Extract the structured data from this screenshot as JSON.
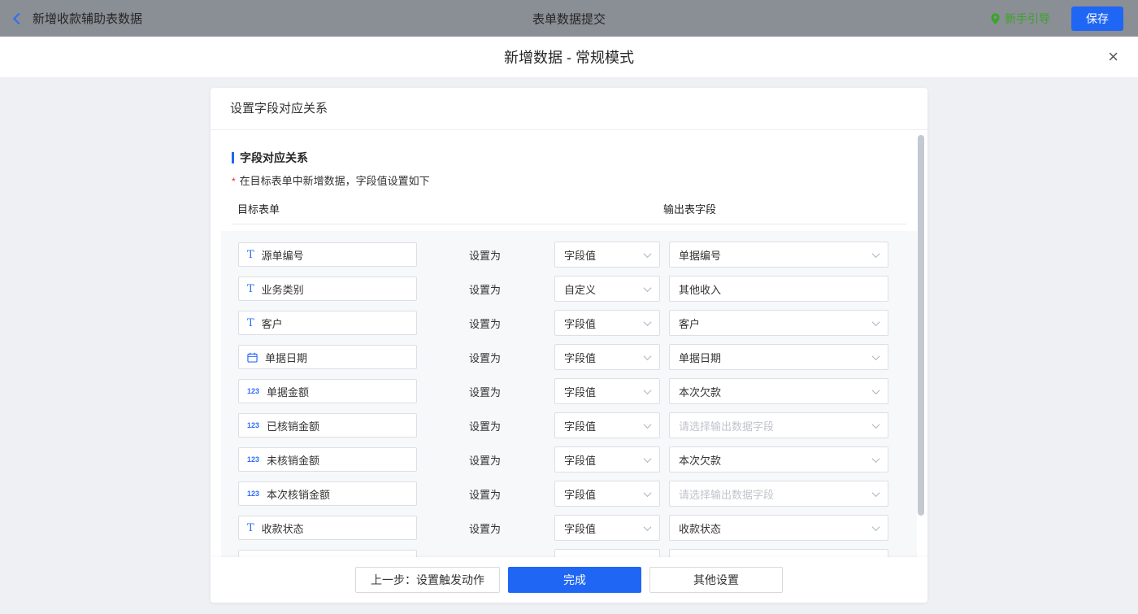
{
  "topbar": {
    "back_label": "新增收款辅助表数据",
    "title": "表单数据提交",
    "guide_label": "新手引导",
    "save_label": "保存"
  },
  "modal": {
    "title": "新增数据 - 常规模式",
    "close_glyph": "×"
  },
  "card": {
    "header_title": "设置字段对应关系",
    "section_title": "字段对应关系",
    "note_mark": "*",
    "note_text": "在目标表单中新增数据，字段值设置如下",
    "columns": {
      "target": "目标表单",
      "output": "输出表字段"
    },
    "set_as_label": "设置为",
    "rows": [
      {
        "icon": "text-field-icon",
        "field": "源单编号",
        "mode": "字段值",
        "output": "单据编号"
      },
      {
        "icon": "text-field-icon",
        "field": "业务类别",
        "mode": "自定义",
        "output": "其他收入",
        "output_plain": true
      },
      {
        "icon": "text-field-icon",
        "field": "客户",
        "mode": "字段值",
        "output": "客户"
      },
      {
        "icon": "date-field-icon",
        "field": "单据日期",
        "mode": "字段值",
        "output": "单据日期"
      },
      {
        "icon": "number-field-icon",
        "field": "单据金额",
        "mode": "字段值",
        "output": "本次欠款"
      },
      {
        "icon": "number-field-icon",
        "field": "已核销金额",
        "mode": "字段值",
        "output": "请选择输出数据字段",
        "output_placeholder": true
      },
      {
        "icon": "number-field-icon",
        "field": "未核销金额",
        "mode": "字段值",
        "output": "本次欠款"
      },
      {
        "icon": "number-field-icon",
        "field": "本次核销金额",
        "mode": "字段值",
        "output": "请选择输出数据字段",
        "output_placeholder": true
      },
      {
        "icon": "text-field-icon",
        "field": "收款状态",
        "mode": "字段值",
        "output": "收款状态"
      }
    ]
  },
  "footer": {
    "prev_label": "上一步：设置触发动作",
    "done_label": "完成",
    "other_label": "其他设置"
  },
  "icons": {
    "back": "chevron-left",
    "guide": "location-pin",
    "close": "x",
    "text_field_glyph": "T",
    "number_field_glyph": "123",
    "date_field": "calendar",
    "dropdown": "chevron-down"
  },
  "colors": {
    "accent_blue": "#1f66f5",
    "field_icon_blue": "#2e6cf6",
    "guide_green": "#3aa526",
    "topbar_gray": "#8a8e95",
    "page_bg": "#eef0f4",
    "rows_bg": "#f7f8fa",
    "placeholder_gray": "#c0c4cc",
    "required_red": "#f5222d",
    "border_gray": "#dcdfe6"
  }
}
